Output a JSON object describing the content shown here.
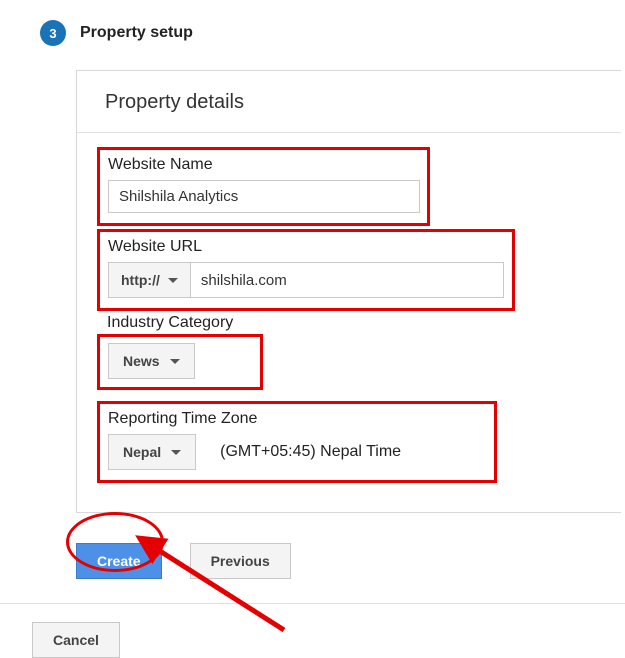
{
  "step": {
    "number": "3",
    "title": "Property setup"
  },
  "card": {
    "title": "Property details"
  },
  "fields": {
    "websiteName": {
      "label": "Website Name",
      "value": "Shilshila Analytics"
    },
    "websiteUrl": {
      "label": "Website URL",
      "protocol": "http://",
      "value": "shilshila.com"
    },
    "industry": {
      "label": "Industry Category",
      "value": "News"
    },
    "timezone": {
      "label": "Reporting Time Zone",
      "country": "Nepal",
      "offset": "(GMT+05:45) Nepal Time"
    }
  },
  "buttons": {
    "create": "Create",
    "previous": "Previous",
    "cancel": "Cancel"
  }
}
